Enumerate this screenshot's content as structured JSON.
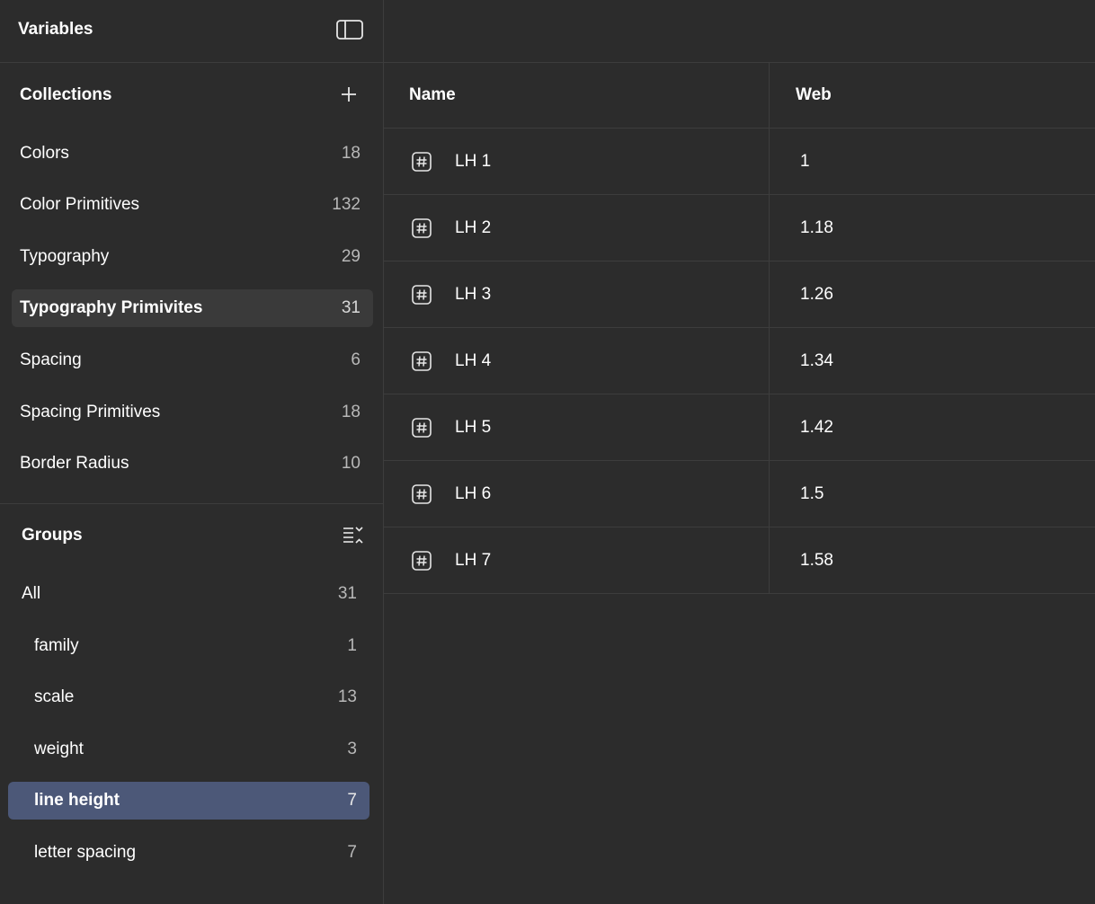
{
  "header": {
    "title": "Variables",
    "panel_icon": "sidebar-toggle-icon"
  },
  "collections": {
    "heading": "Collections",
    "add_icon": "plus-icon",
    "items": [
      {
        "label": "Colors",
        "count": "18"
      },
      {
        "label": "Color Primitives",
        "count": "132"
      },
      {
        "label": "Typography",
        "count": "29"
      },
      {
        "label": "Typography Primivites",
        "count": "31"
      },
      {
        "label": "Spacing",
        "count": "6"
      },
      {
        "label": "Spacing Primitives",
        "count": "18"
      },
      {
        "label": "Border Radius",
        "count": "10"
      }
    ],
    "selected_index": 3
  },
  "groups": {
    "heading": "Groups",
    "menu_icon": "collapse-list-icon",
    "items": [
      {
        "label": "All",
        "count": "31"
      },
      {
        "label": "family",
        "count": "1"
      },
      {
        "label": "scale",
        "count": "13"
      },
      {
        "label": "weight",
        "count": "3"
      },
      {
        "label": "line height",
        "count": "7"
      },
      {
        "label": "letter spacing",
        "count": "7"
      }
    ],
    "selected_index": 4
  },
  "table": {
    "columns": [
      "Name",
      "Web"
    ],
    "row_icon": "number-variable-icon",
    "rows": [
      {
        "name": "LH 1",
        "web": "1"
      },
      {
        "name": "LH 2",
        "web": "1.18"
      },
      {
        "name": "LH 3",
        "web": "1.26"
      },
      {
        "name": "LH 4",
        "web": "1.34"
      },
      {
        "name": "LH 5",
        "web": "1.42"
      },
      {
        "name": "LH 6",
        "web": "1.5"
      },
      {
        "name": "LH 7",
        "web": "1.58"
      }
    ]
  },
  "colors": {
    "background": "#2c2c2c",
    "border": "#3d3d3d",
    "selected_collection": "#3a3a3a",
    "selected_group": "#4c5878"
  }
}
